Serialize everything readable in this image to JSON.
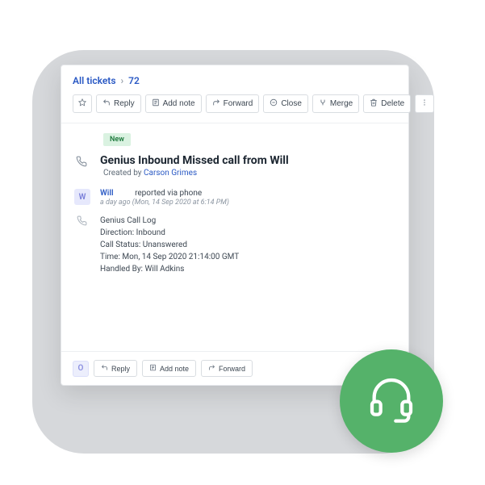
{
  "breadcrumb": {
    "all_tickets": "All tickets",
    "ticket_id": "72"
  },
  "toolbar": {
    "reply": "Reply",
    "add_note": "Add note",
    "forward": "Forward",
    "close": "Close",
    "merge": "Merge",
    "delete": "Delete"
  },
  "ticket": {
    "status_badge": "New",
    "title": "Genius Inbound Missed call from Will",
    "created_by_label": "Created by",
    "created_by_name": "Carson Grimes",
    "reporter": {
      "avatar_letter": "W",
      "name": "Will",
      "reported_text": "reported via phone",
      "time_ago": "a day ago (Mon, 14 Sep 2020 at 6:14 PM)"
    },
    "call_log": {
      "heading": "Genius Call Log",
      "direction": "Direction: Inbound",
      "status": "Call Status: Unanswered",
      "time": "Time: Mon, 14 Sep 2020 21:14:00 GMT",
      "handled_by": "Handled By: Will Adkins"
    }
  },
  "footer": {
    "avatar_letter": "O",
    "reply": "Reply",
    "add_note": "Add note",
    "forward": "Forward"
  }
}
